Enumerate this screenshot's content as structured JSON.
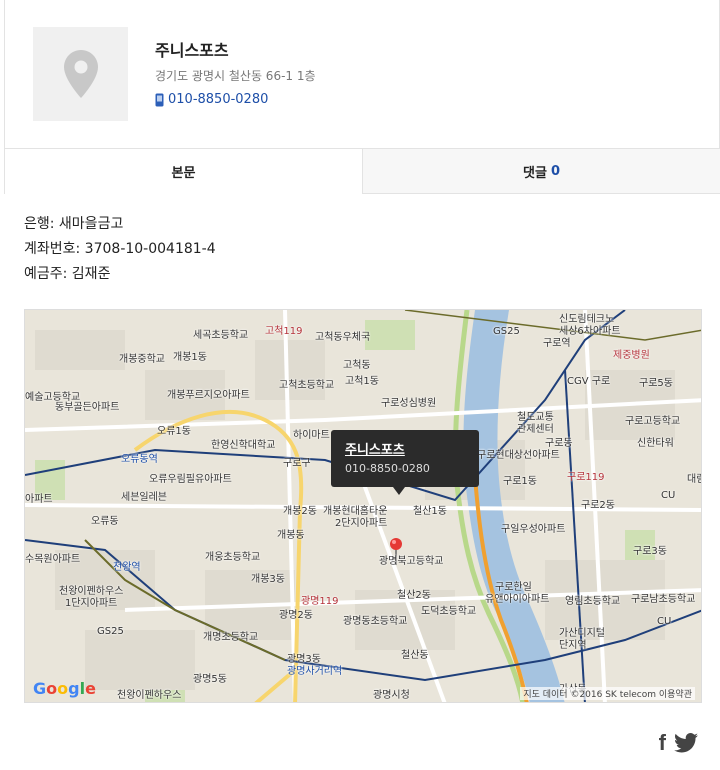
{
  "place": {
    "name": "주니스포츠",
    "address": "경기도 광명시 철산동 66-1 1층",
    "phone": "010-8850-0280"
  },
  "tabs": [
    {
      "label": "본문"
    },
    {
      "label": "댓글",
      "count": "0"
    }
  ],
  "content": {
    "bank": "은행: 새마을금고",
    "account": "계좌번호: 3708-10-004181-4",
    "holder": "예금주: 김재준"
  },
  "map": {
    "tooltip_name": "주니스포츠",
    "tooltip_phone": "010-8850-0280",
    "logo": "Google",
    "copyright": "지도 데이터 ©2016 SK telecom   이용약관",
    "labels": [
      {
        "text": "세곡초등학교"
      },
      {
        "text": "고척119"
      },
      {
        "text": "고척동우체국"
      },
      {
        "text": "GS25"
      },
      {
        "text": "구로역"
      },
      {
        "text": "신도림테크노"
      },
      {
        "text": "세상6차아파트"
      },
      {
        "text": "개봉중학교"
      },
      {
        "text": "개봉1동"
      },
      {
        "text": "고척동"
      },
      {
        "text": "제중병원"
      },
      {
        "text": "예술고등학교"
      },
      {
        "text": "개봉푸르지오아파트"
      },
      {
        "text": "고척초등학교"
      },
      {
        "text": "고척1동"
      },
      {
        "text": "CGV 구로"
      },
      {
        "text": "구로5동"
      },
      {
        "text": "동부골든아파트"
      },
      {
        "text": "구로성심병원"
      },
      {
        "text": "철도교통"
      },
      {
        "text": "관제센터"
      },
      {
        "text": "구로고등학교"
      },
      {
        "text": "오류1동"
      },
      {
        "text": "한영신학대학교"
      },
      {
        "text": "하이마트"
      },
      {
        "text": "구로동"
      },
      {
        "text": "신한타워"
      },
      {
        "text": "오류동역"
      },
      {
        "text": "구로구"
      },
      {
        "text": "구로현대상선아파트"
      },
      {
        "text": "오류우림필유아파트"
      },
      {
        "text": "구로119"
      },
      {
        "text": "아파트"
      },
      {
        "text": "세븐일레븐"
      },
      {
        "text": "개봉2동"
      },
      {
        "text": "개봉현대홈타운"
      },
      {
        "text": "2단지아파트"
      },
      {
        "text": "구로1동"
      },
      {
        "text": "CU"
      },
      {
        "text": "구로2동"
      },
      {
        "text": "오류동"
      },
      {
        "text": "철산1동"
      },
      {
        "text": "구일우성아파트"
      },
      {
        "text": "개봉동"
      },
      {
        "text": "수목원아파트"
      },
      {
        "text": "천왕역"
      },
      {
        "text": "광명북고등학교"
      },
      {
        "text": "개웅초등학교"
      },
      {
        "text": "천왕이펜하우스"
      },
      {
        "text": "1단지아파트"
      },
      {
        "text": "개봉3동"
      },
      {
        "text": "광명119"
      },
      {
        "text": "철산2동"
      },
      {
        "text": "구로한일"
      },
      {
        "text": "유앤아이아파트"
      },
      {
        "text": "영림초등학교"
      },
      {
        "text": "구로남초등학교"
      },
      {
        "text": "도덕초등학교"
      },
      {
        "text": "GS25"
      },
      {
        "text": "광명2동"
      },
      {
        "text": "광명동초등학교"
      },
      {
        "text": "가산디지털"
      },
      {
        "text": "단지역"
      },
      {
        "text": "개명초등학교"
      },
      {
        "text": "광명3동"
      },
      {
        "text": "철산동"
      },
      {
        "text": "광명사거리역"
      },
      {
        "text": "광명5동"
      },
      {
        "text": "천왕이펜하우스"
      },
      {
        "text": "광명시청"
      },
      {
        "text": "가산동"
      },
      {
        "text": "구로3동"
      },
      {
        "text": "대림"
      },
      {
        "text": "CU"
      }
    ]
  },
  "share": {
    "facebook_glyph": "f"
  }
}
